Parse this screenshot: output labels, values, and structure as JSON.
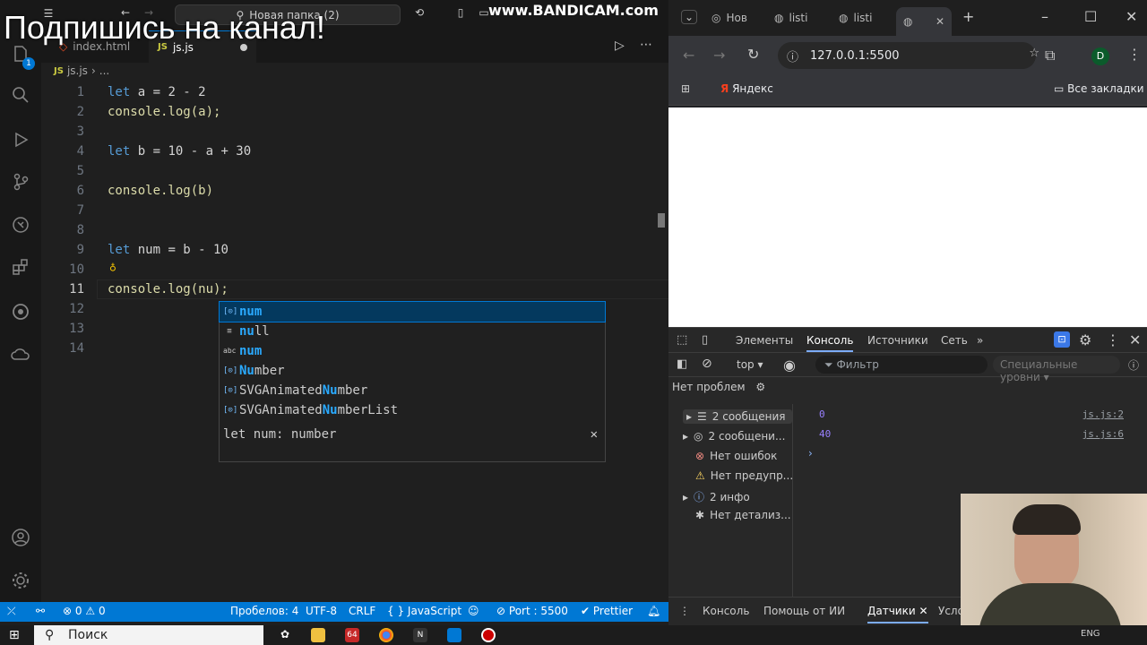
{
  "overlay_title": "Подпишись на канал!",
  "watermark": "www.BANDICAM.com",
  "vscode": {
    "command_center": "Новая папка (2)",
    "tabs": [
      {
        "label": "index.html"
      },
      {
        "label": "js.js"
      }
    ],
    "breadcrumb": {
      "file": "js.js",
      "sep": "›",
      "more": "..."
    },
    "lines": [
      {
        "n": "1"
      },
      {
        "n": "2"
      },
      {
        "n": "3"
      },
      {
        "n": "4"
      },
      {
        "n": "5"
      },
      {
        "n": "6"
      },
      {
        "n": "7"
      },
      {
        "n": "8"
      },
      {
        "n": "9"
      },
      {
        "n": "10"
      },
      {
        "n": "11"
      },
      {
        "n": "12"
      },
      {
        "n": "13"
      },
      {
        "n": "14"
      }
    ],
    "code": {
      "l1_kw": "let",
      "l1_rest": " a = 2 - 2",
      "l2": "console.log(a);",
      "l4_kw": "let",
      "l4_rest": " b = 10 - a + 30",
      "l6": "console.log(b)",
      "l9_kw": "let",
      "l9_rest": " num = b - 10",
      "l11": "console.log(nu);"
    },
    "suggestions": [
      {
        "icon": "[⊙]",
        "pre": "num",
        "post": ""
      },
      {
        "icon": "≡",
        "pre": "nu",
        "post": "ll"
      },
      {
        "icon": "abc",
        "pre": "num",
        "post": ""
      },
      {
        "icon": "[⊙]",
        "pre": "Nu",
        "post": "mber"
      },
      {
        "icon": "[⊙]",
        "pre0": "SVGAnimated",
        "pre": "Nu",
        "post": "mber"
      },
      {
        "icon": "[⊙]",
        "pre0": "SVGAnimated",
        "pre": "Nu",
        "post": "mberList"
      }
    ],
    "suggest_detail": "let num: number",
    "suggest_close": "✕",
    "status": {
      "errors": "0",
      "warnings": "0",
      "spaces": "Пробелов: 4",
      "encoding": "UTF-8",
      "eol": "CRLF",
      "language": "JavaScript",
      "port": "Port : 5500",
      "prettier": "Prettier"
    },
    "activity_badge": "1"
  },
  "browser": {
    "tabs": [
      "Нов",
      "listi",
      "listi"
    ],
    "url": "127.0.0.1:5500",
    "profile": "D",
    "bookmark_yandex": "Яндекс",
    "all_bookmarks": "Все закладки",
    "devtools": {
      "tabs": [
        "Элементы",
        "Консоль",
        "Источники",
        "Сеть"
      ],
      "context": "top",
      "filter_placeholder": "Фильтр",
      "levels": "Специальные уровни",
      "no_problems": "Нет проблем",
      "side": [
        "2 сообщения",
        "2 сообщени...",
        "Нет ошибок",
        "Нет предупр...",
        "2 инфо",
        "Нет детализ..."
      ],
      "logs": [
        {
          "value": "0",
          "source": "js.js:2"
        },
        {
          "value": "40",
          "source": "js.js:6"
        }
      ],
      "bottom_tabs": [
        "Консоль",
        "Помощь от ИИ",
        "Датчики",
        "Усло"
      ]
    }
  },
  "taskbar": {
    "search": "Поиск",
    "app_label": "64",
    "lang": "ENG"
  }
}
